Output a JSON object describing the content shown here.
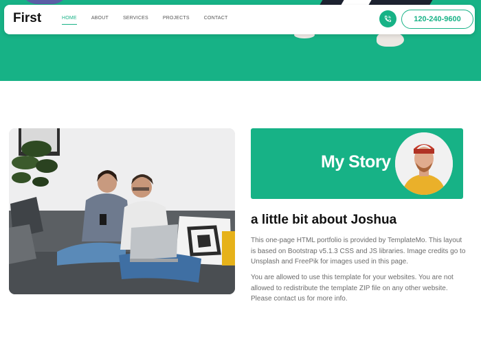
{
  "colors": {
    "accent": "#17b286",
    "heading": "#111111",
    "body_text": "#6b6b6b"
  },
  "navbar": {
    "brand": "First",
    "links": [
      {
        "label": "HOME",
        "active": true
      },
      {
        "label": "ABOUT",
        "active": false
      },
      {
        "label": "SERVICES",
        "active": false
      },
      {
        "label": "PROJECTS",
        "active": false
      },
      {
        "label": "CONTACT",
        "active": false
      }
    ],
    "phone_icon": "phone-icon",
    "phone_number": "120-240-9600"
  },
  "story": {
    "title": "My Story",
    "heading": "a little bit about Joshua",
    "paragraph1": "This one-page HTML portfolio is provided by TemplateMo. This layout is based on Bootstrap v5.1.3 CSS and JS libraries. Image credits go to Unsplash and FreePik for images used in this page.",
    "paragraph2": "You are allowed to use this template for your websites. You are not allowed to redistribute the template ZIP file on any other website. Please contact us for more info."
  }
}
